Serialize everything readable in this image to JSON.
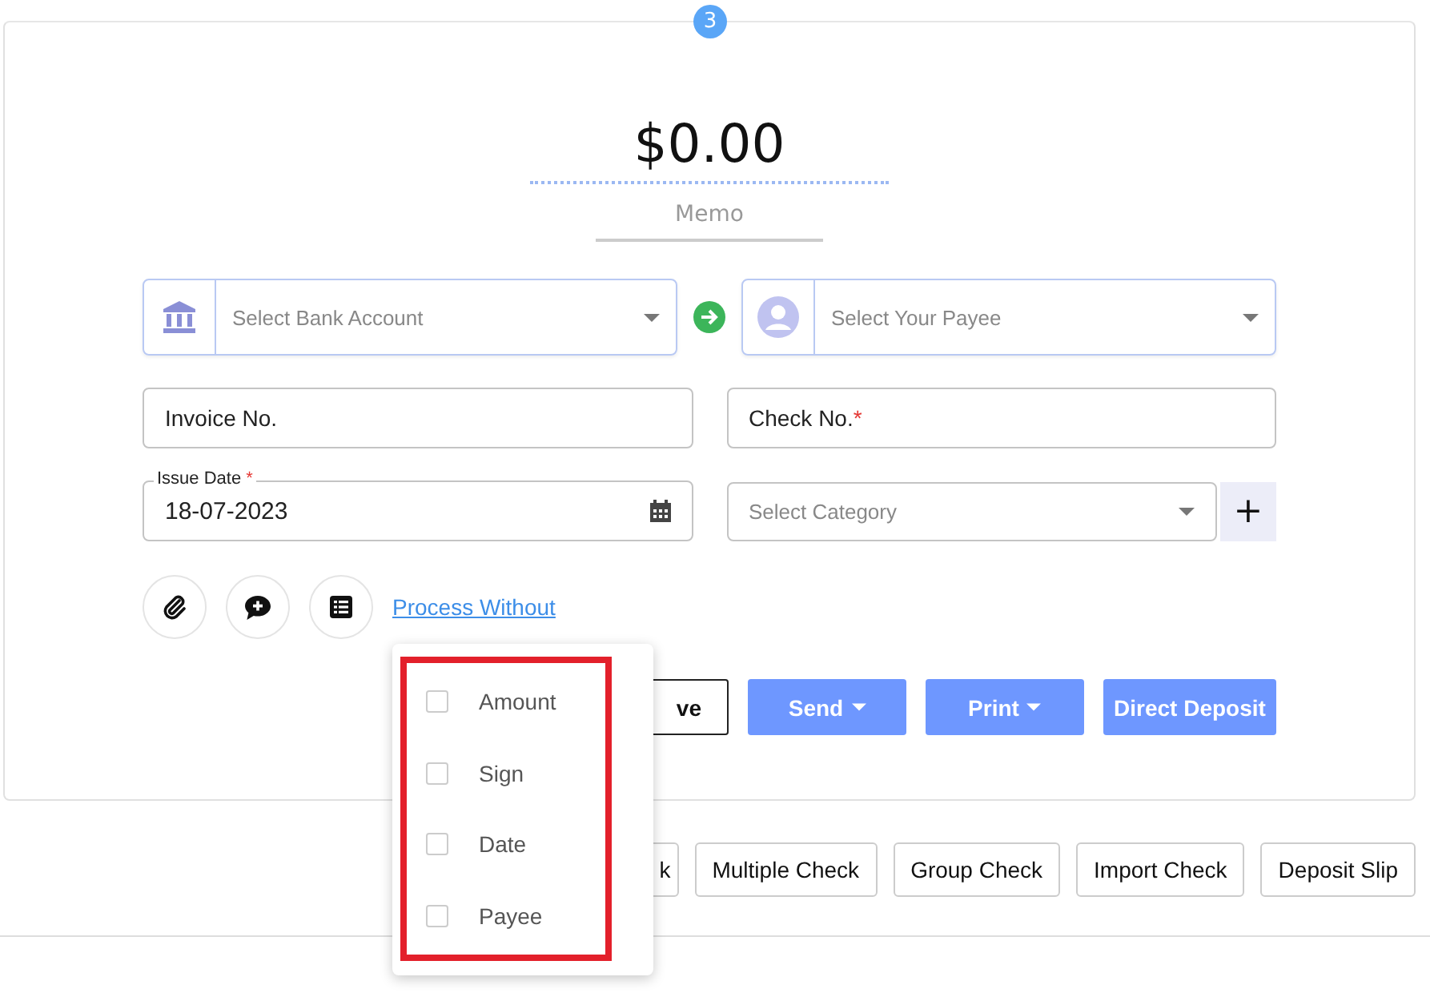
{
  "step_badge": "3",
  "amount": "$0.00",
  "memo": {
    "placeholder": "Memo"
  },
  "bank_account": {
    "placeholder": "Select Bank Account"
  },
  "payee": {
    "placeholder": "Select Your Payee"
  },
  "invoice": {
    "label": "Invoice No."
  },
  "check_no": {
    "label": "Check No.",
    "required_mark": "*"
  },
  "issue_date": {
    "label": "Issue Date",
    "required_mark": "*",
    "value": "18-07-2023"
  },
  "category": {
    "placeholder": "Select Category"
  },
  "add_category_button": "+",
  "process_without_link": "Process Without",
  "action_buttons": [
    {
      "label": "ve",
      "kind": "outline"
    },
    {
      "label": "Send",
      "kind": "dropdown"
    },
    {
      "label": "Print",
      "kind": "dropdown"
    },
    {
      "label": "Direct Deposit",
      "kind": "primary"
    }
  ],
  "bottom_buttons": [
    "k",
    "Multiple Check",
    "Group Check",
    "Import Check",
    "Deposit Slip"
  ],
  "process_without_menu": [
    {
      "label": "Amount",
      "checked": false
    },
    {
      "label": "Sign",
      "checked": false
    },
    {
      "label": "Date",
      "checked": false
    },
    {
      "label": "Payee",
      "checked": false
    }
  ]
}
